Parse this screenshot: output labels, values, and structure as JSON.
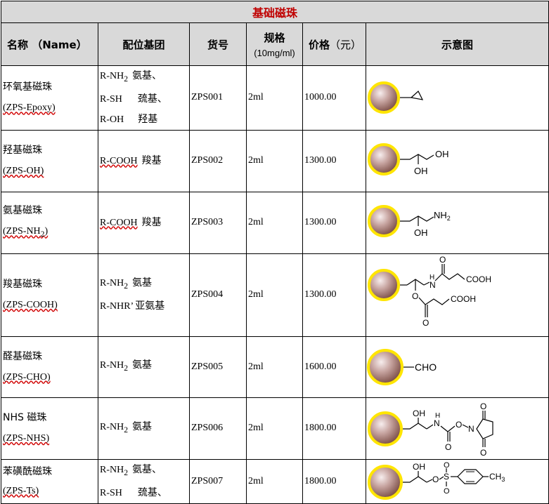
{
  "title": "基础磁珠",
  "headers": {
    "name": "名称 （Name）",
    "ligand": "配位基团",
    "catalog": "货号",
    "spec": "规格",
    "spec_unit": "(10mg/ml)",
    "price": "价格",
    "price_unit": "（元）",
    "diagram": "示意图"
  },
  "rows": [
    {
      "name_cn": "环氧基磁珠",
      "name_code": "(ZPS-Epoxy)",
      "ligands": [
        {
          "formula": "R-NH",
          "sub": "2",
          "group": "氨基、"
        },
        {
          "formula": "R-SH",
          "sub": "",
          "group": "巯基、"
        },
        {
          "formula": "R-OH",
          "sub": "",
          "group": "羟基"
        }
      ],
      "catalog": "ZPS001",
      "spec": "2ml",
      "price": "1000.00"
    },
    {
      "name_cn": "羟基磁珠",
      "name_code": "(ZPS-OH)",
      "ligands": [
        {
          "formula": "R-COOH",
          "sub": "",
          "group": "羧基"
        }
      ],
      "catalog": "ZPS002",
      "spec": "2ml",
      "price": "1300.00",
      "diagram_labels": {
        "oh1": "OH",
        "oh2": "OH"
      }
    },
    {
      "name_cn": "氨基磁珠",
      "name_code_main": "(ZPS-NH",
      "name_code_sub": "2",
      "name_code_end": ")",
      "ligands": [
        {
          "formula": "R-COOH",
          "sub": "",
          "group": "羧基"
        }
      ],
      "catalog": "ZPS003",
      "spec": "2ml",
      "price": "1300.00",
      "diagram_labels": {
        "nh2": "NH",
        "nh2_sub": "2",
        "oh": "OH"
      }
    },
    {
      "name_cn": "羧基磁珠",
      "name_code": "(ZPS-COOH)",
      "ligands": [
        {
          "formula": "R-NH",
          "sub": "2",
          "group": "氨基"
        },
        {
          "formula": "R-NHR’",
          "sub": "",
          "group": "亚氨基"
        }
      ],
      "catalog": "ZPS004",
      "spec": "2ml",
      "price": "1300.00",
      "diagram_labels": {
        "o_top": "O",
        "n": "N",
        "h": "H",
        "cooh1": "COOH",
        "o_link": "O",
        "cooh2": "COOH",
        "o_bottom": "O"
      }
    },
    {
      "name_cn": "醛基磁珠",
      "name_code": "(ZPS-CHO)",
      "ligands": [
        {
          "formula": "R-NH",
          "sub": "2",
          "group": "氨基"
        }
      ],
      "catalog": "ZPS005",
      "spec": "2ml",
      "price": "1600.00",
      "diagram_labels": {
        "cho": "CHO"
      }
    },
    {
      "name_cn": "NHS 磁珠",
      "name_code": "(ZPS-NHS)",
      "ligands": [
        {
          "formula": "R-NH",
          "sub": "2",
          "group": "氨基"
        }
      ],
      "catalog": "ZPS006",
      "spec": "2ml",
      "price": "1800.00",
      "diagram_labels": {
        "oh": "OH",
        "h": "H",
        "n": "N",
        "o_link": "O",
        "n_ring": "N",
        "o_carbonyl": "O",
        "o_top": "O",
        "o_bot": "O"
      }
    },
    {
      "name_cn": "苯磺酰磁珠",
      "name_code": "(ZPS-Ts)",
      "ligands": [
        {
          "formula": "R-NH",
          "sub": "2",
          "group": "氨基、"
        },
        {
          "formula": "R-SH",
          "sub": "",
          "group": "巯基、"
        }
      ],
      "catalog": "ZPS007",
      "spec": "2ml",
      "price": "1800.00",
      "diagram_labels": {
        "oh": "OH",
        "o_link": "O",
        "s": "S",
        "o_up": "O",
        "o_dn": "O",
        "ch3": "CH",
        "ch3_sub": "3"
      }
    }
  ],
  "colors": {
    "header_bg": "#d9d9d9",
    "title_text": "#c00000",
    "bead_ring": "#ffe500",
    "bead_fill": "#a07870",
    "spell_underline": "#d00000"
  }
}
